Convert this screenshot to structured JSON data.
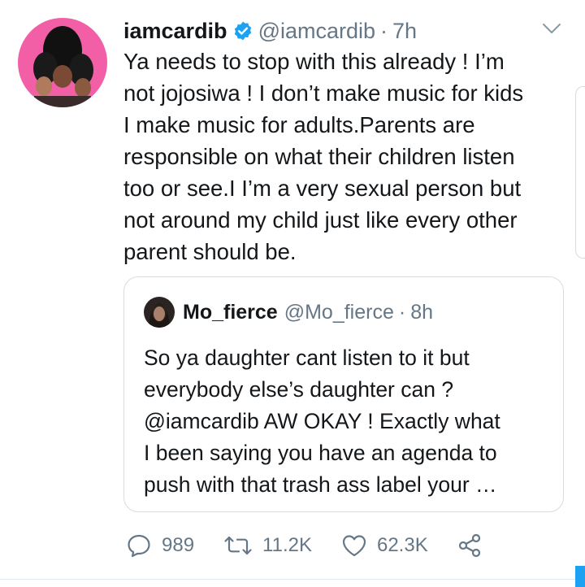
{
  "tweet": {
    "display_name": "iamcardib",
    "verified_icon": "verified-badge-icon",
    "handle": "@iamcardib",
    "separator": "·",
    "time": "7h",
    "text_lines": [
      "Ya needs to stop with this already ! I’m",
      "not jojosiwa ! I don’t make music for kids",
      "I make music for adults.Parents are",
      "responsible on what their children listen",
      "too or see.I I’m a very sexual person but",
      "not around my child just like every other",
      "parent should be."
    ]
  },
  "quoted_tweet": {
    "display_name": "Mo_fierce",
    "handle": "@Mo_fierce",
    "separator": "·",
    "time": "8h",
    "text_lines": [
      "So ya daughter cant listen to it but",
      "everybody else’s daughter can ?",
      "@iamcardib AW OKAY ! Exactly what",
      "I been saying you have an agenda to",
      "push with that trash ass label your …"
    ]
  },
  "actions": {
    "reply_count": "989",
    "retweet_count": "11.2K",
    "like_count": "62.3K",
    "icons": [
      "reply-icon",
      "retweet-icon",
      "like-icon",
      "share-icon"
    ]
  },
  "colors": {
    "text": "#14171a",
    "secondary": "#657786",
    "verified": "#1da1f2",
    "border": "#d7dce0",
    "avatar_bg": "#f25fa6"
  }
}
